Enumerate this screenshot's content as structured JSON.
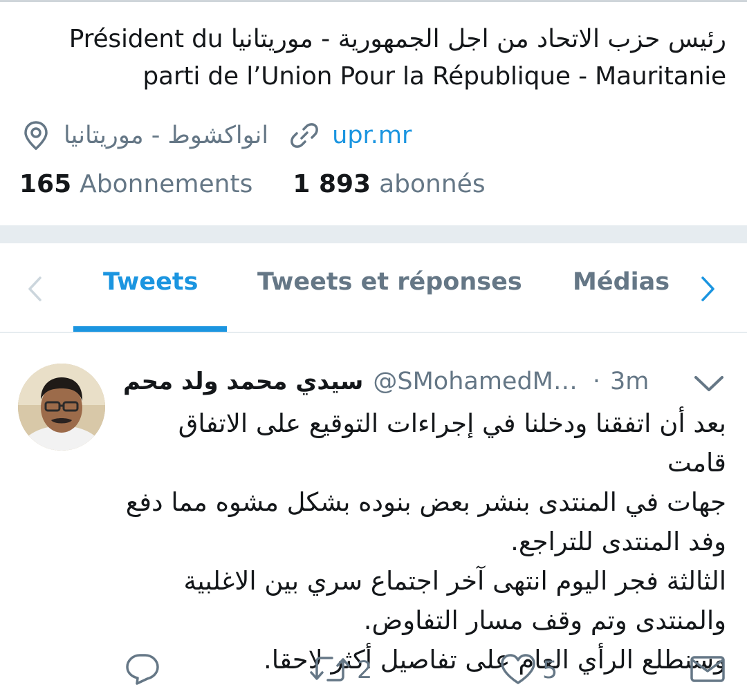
{
  "profile": {
    "bio_line1": "رئيس حزب الاتحاد من اجل الجمهورية - موريتانيا Président du",
    "bio_line2": "parti de l’Union Pour la République - Mauritanie",
    "location": "انواكشوط - موريتانيا",
    "website": "upr.mr",
    "following_count": "165",
    "following_label": "Abonnements",
    "followers_count": "1 893",
    "followers_label": "abonnés"
  },
  "tabs": [
    {
      "label": "Tweets",
      "active": true
    },
    {
      "label": "Tweets et réponses",
      "active": false
    },
    {
      "label": "Médias",
      "active": false
    }
  ],
  "tweet": {
    "display_name": "سيدي محمد ولد محم",
    "handle": "@SMohamedM…",
    "separator": "·",
    "time": "3m",
    "lines": [
      "بعد أن اتفقنا ودخلنا في إجراءات التوقيع على الاتفاق قامت",
      "جهات في المنتدى بنشر بعض بنوده بشكل مشوه مما دفع",
      "وفد المنتدى للتراجع.",
      "الثالثة فجر اليوم انتهى آخر اجتماع سري بين الاغلبية",
      "والمنتدى وتم وقف مسار التفاوض.",
      "وسنطلع الرأي العام على تفاصيل أكثر لاحقا."
    ],
    "retweet_count": "2",
    "like_count": "5"
  },
  "colors": {
    "accent": "#1b95e0",
    "secondary_text": "#657786",
    "primary_text": "#14171a",
    "separator": "#e6ecf0"
  },
  "icons": {
    "location": "location-pin-icon",
    "link": "link-icon",
    "reply": "reply-icon",
    "retweet": "retweet-icon",
    "like": "heart-icon",
    "dm": "envelope-icon",
    "caret": "chevron-down-icon",
    "tab_prev": "chevron-left-icon",
    "tab_next": "chevron-right-icon"
  }
}
